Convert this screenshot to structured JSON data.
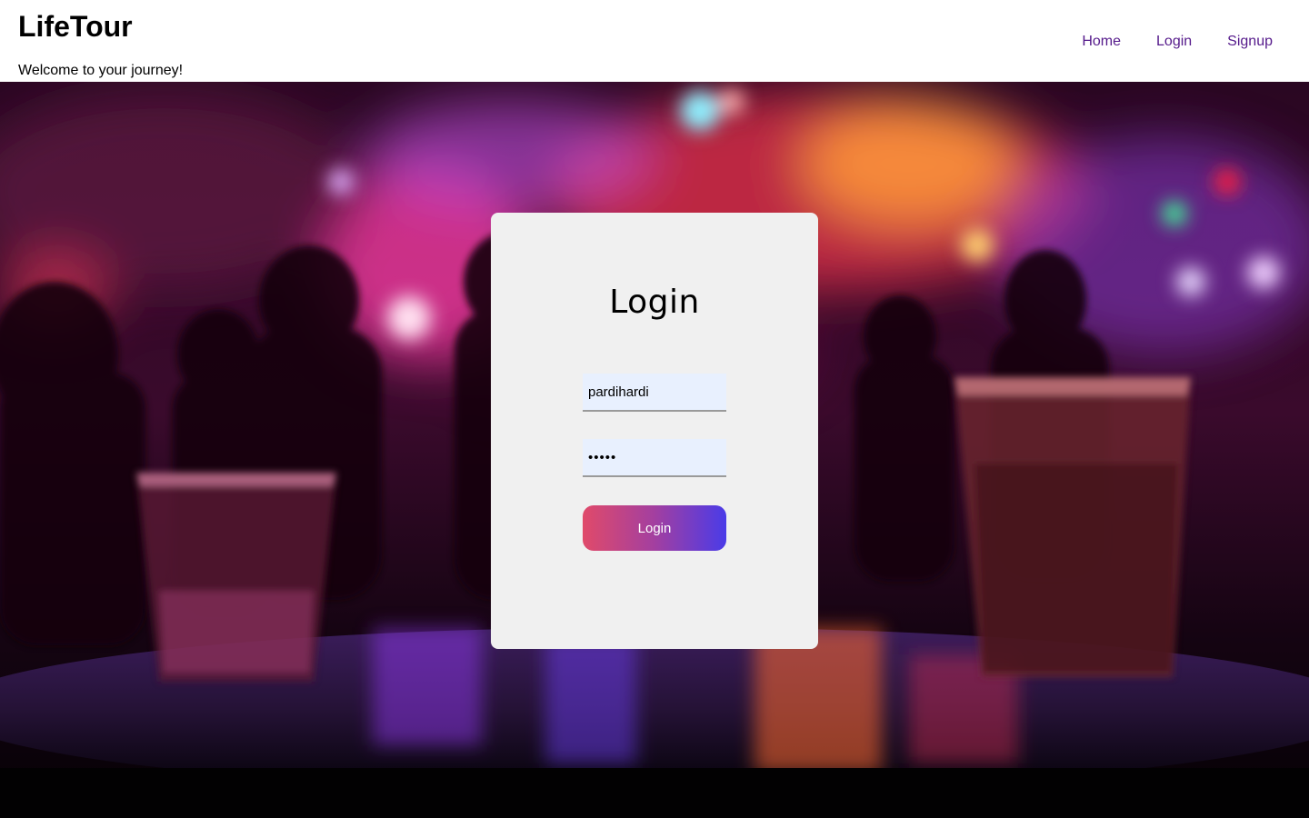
{
  "header": {
    "title": "LifeTour",
    "tagline": "Welcome to your journey!",
    "nav": [
      {
        "label": "Home"
      },
      {
        "label": "Login"
      },
      {
        "label": "Signup"
      }
    ],
    "link_color": "#551a8b"
  },
  "background": {
    "icon": "nightclub-photo"
  },
  "login_card": {
    "title": "Login",
    "username_value": "pardihardi",
    "password_value": "12345",
    "submit_label": "Login",
    "card_color": "#f0f0f0",
    "button_gradient": [
      "#e04a6a",
      "#4a3be8"
    ]
  }
}
